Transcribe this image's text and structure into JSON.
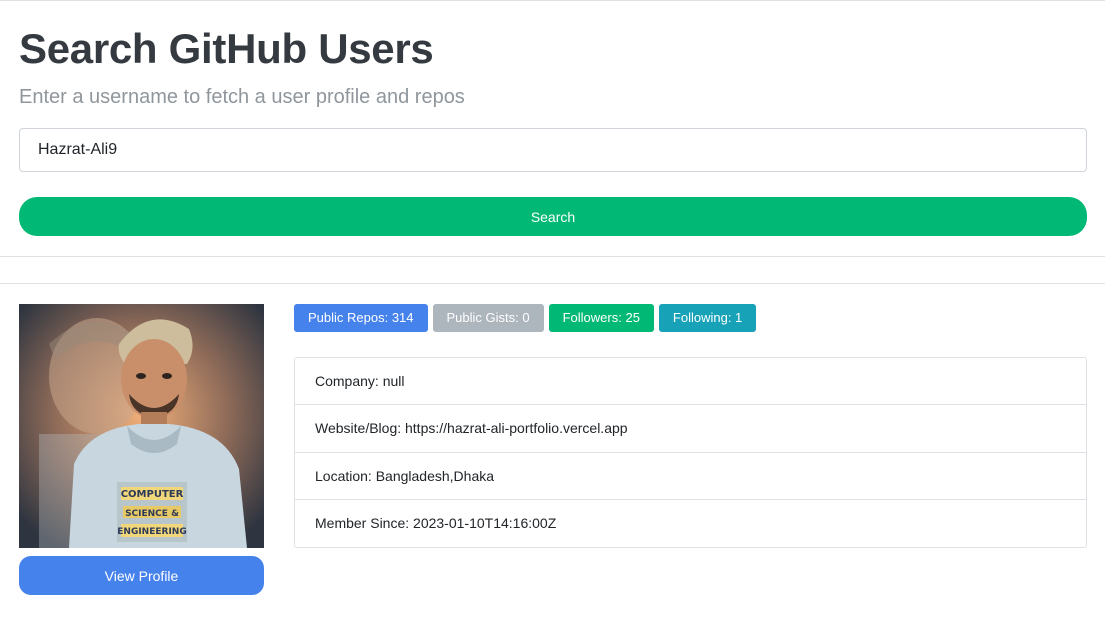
{
  "header": {
    "title": "Search GitHub Users",
    "subtitle": "Enter a username to fetch a user profile and repos"
  },
  "search": {
    "value": "Hazrat-Ali9",
    "button_label": "Search",
    "button_color": "#02b875"
  },
  "profile": {
    "avatar_icon": "user-avatar-photo",
    "view_profile_label": "View Profile",
    "badges": [
      {
        "label": "Public Repos: 314",
        "color": "#4582ec"
      },
      {
        "label": "Public Gists: 0",
        "color": "#adb5bd"
      },
      {
        "label": "Followers: 25",
        "color": "#02b875"
      },
      {
        "label": "Following: 1",
        "color": "#17a2b8"
      }
    ],
    "details": [
      "Company: null",
      "Website/Blog: https://hazrat-ali-portfolio.vercel.app",
      "Location: Bangladesh,Dhaka",
      "Member Since: 2023-01-10T14:16:00Z"
    ]
  }
}
